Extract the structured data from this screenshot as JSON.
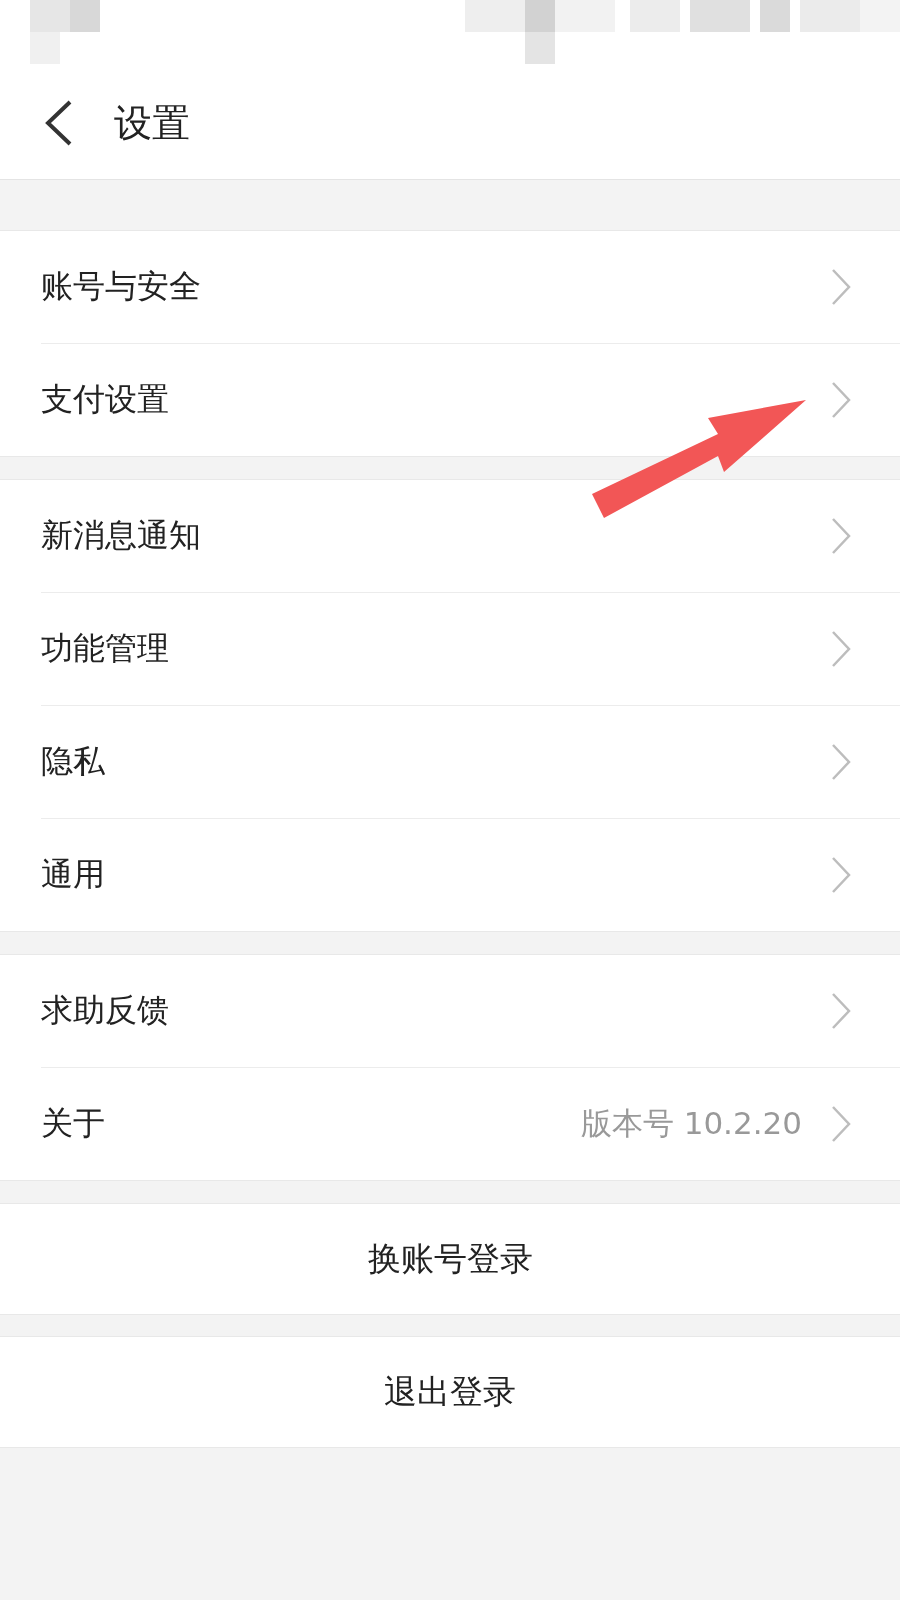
{
  "header": {
    "title": "设置"
  },
  "groups": [
    {
      "items": [
        {
          "label": "账号与安全"
        },
        {
          "label": "支付设置"
        }
      ]
    },
    {
      "items": [
        {
          "label": "新消息通知"
        },
        {
          "label": "功能管理"
        },
        {
          "label": "隐私"
        },
        {
          "label": "通用"
        }
      ]
    },
    {
      "items": [
        {
          "label": "求助反馈"
        },
        {
          "label": "关于",
          "value": "版本号 10.2.20"
        }
      ]
    }
  ],
  "buttons": [
    {
      "label": "换账号登录"
    },
    {
      "label": "退出登录"
    }
  ]
}
